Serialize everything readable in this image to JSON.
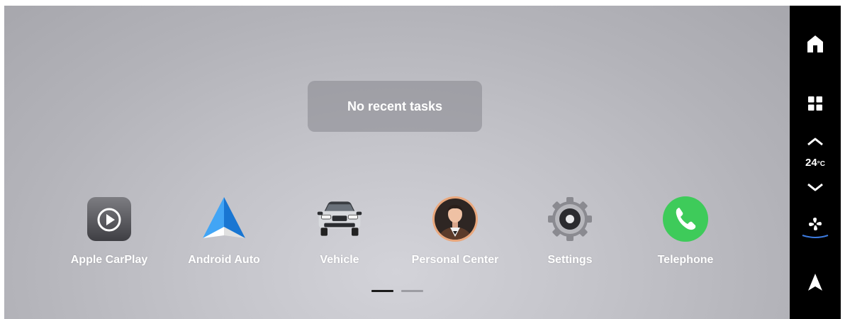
{
  "recent": {
    "message": "No recent tasks"
  },
  "apps": [
    {
      "label": "Apple CarPlay",
      "icon": "apple-carplay-icon"
    },
    {
      "label": "Android Auto",
      "icon": "android-auto-icon"
    },
    {
      "label": "Vehicle",
      "icon": "vehicle-icon"
    },
    {
      "label": "Personal Center",
      "icon": "personal-center-icon"
    },
    {
      "label": "Settings",
      "icon": "settings-icon"
    },
    {
      "label": "Telephone",
      "icon": "telephone-icon"
    }
  ],
  "pager": {
    "pages": 2,
    "current": 1,
    "active_color": "#1a1a1a",
    "inactive_color": "#9d9da3"
  },
  "sidebar": {
    "items": [
      {
        "icon": "home-icon"
      },
      {
        "icon": "app-grid-icon"
      },
      {
        "icon": "temperature-up-icon"
      },
      {
        "icon": "temperature-down-icon"
      },
      {
        "icon": "fan-icon"
      },
      {
        "icon": "navigation-icon"
      }
    ],
    "temperature": {
      "value": "24",
      "unit": "°C"
    }
  },
  "colors": {
    "telephone_green": "#3ecb5a",
    "android_blue": "#2196f3",
    "fan_indicator": "#3c7be0"
  }
}
